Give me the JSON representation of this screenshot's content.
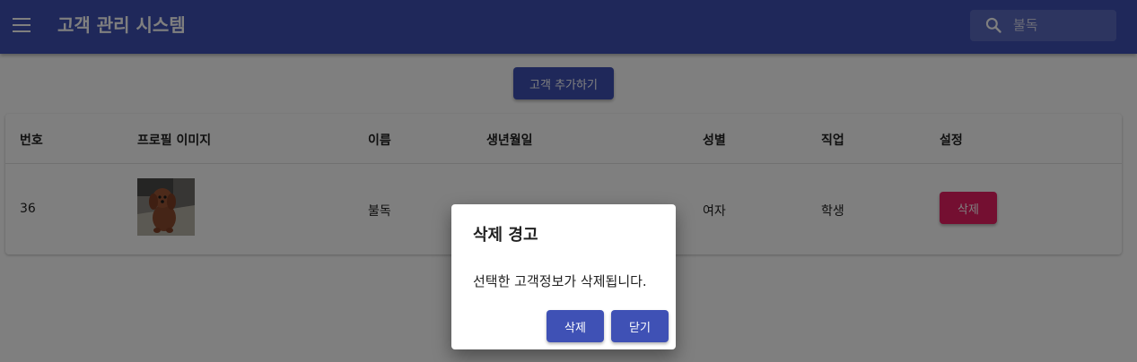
{
  "app": {
    "title": "고객 관리 시스템",
    "search_placeholder": "불독"
  },
  "toolbar": {
    "add_customer_label": "고객 추가하기"
  },
  "table": {
    "columns": [
      "번호",
      "프로필 이미지",
      "이름",
      "생년월일",
      "성별",
      "직업",
      "설정"
    ],
    "rows": [
      {
        "id": "36",
        "name": "불독",
        "birthday": "",
        "gender": "여자",
        "job": "학생",
        "delete_label": "삭제"
      }
    ]
  },
  "dialog": {
    "title": "삭제 경고",
    "message": "선택한 고객정보가 삭제됩니다.",
    "confirm_label": "삭제",
    "close_label": "닫기"
  },
  "colors": {
    "primary": "#3f51b5",
    "secondary": "#e91e63"
  }
}
